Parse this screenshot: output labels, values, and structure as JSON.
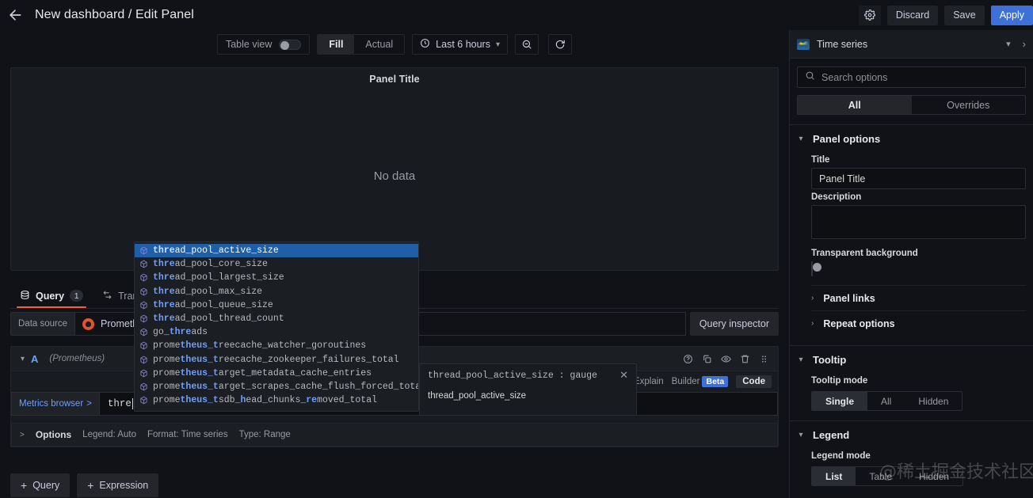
{
  "topbar": {
    "back_icon": "arrow-left-icon",
    "breadcrumb": "New dashboard / Edit Panel",
    "settings_icon": "gear-icon",
    "discard_label": "Discard",
    "save_label": "Save",
    "apply_label": "Apply"
  },
  "toolbar": {
    "table_view_label": "Table view",
    "fill_label": "Fill",
    "actual_label": "Actual",
    "time_range_label": "Last 6 hours",
    "clock_icon": "clock-icon",
    "chevron_icon": "chevron-down-icon",
    "zoom_out_icon": "zoom-out-icon",
    "refresh_icon": "refresh-icon"
  },
  "panel_preview": {
    "title": "Panel Title",
    "no_data": "No data"
  },
  "tabs": [
    {
      "label": "Query",
      "badge": "1",
      "icon": "database-icon",
      "active": true
    },
    {
      "label": "Transform",
      "badge": "",
      "icon": "transform-icon",
      "active": false
    }
  ],
  "query_editor": {
    "data_source_label": "Data source",
    "data_source_value": "Prometheus",
    "data_source_icon": "prometheus-icon",
    "query_inspector_label": "Query inspector",
    "ref_id": "A",
    "ref_ds": "(Prometheus)",
    "row_actions": [
      "help-icon",
      "duplicate-icon",
      "eye-icon",
      "trash-icon",
      "drag-handle-icon"
    ],
    "explain_label": "Explain",
    "builder_label": "Builder",
    "beta_label": "Beta",
    "code_label": "Code",
    "metrics_browser_label": "Metrics browser",
    "metrics_browser_caret": ">",
    "code_value": "thre",
    "options": {
      "caret": ">",
      "title": "Options",
      "legend": "Legend: Auto",
      "format": "Format: Time series",
      "type": "Type: Range"
    },
    "add_query_label": "Query",
    "add_expression_label": "Expression"
  },
  "doc_popup": {
    "signature": "thread_pool_active_size : gauge",
    "close_icon": "close-icon",
    "body": "thread_pool_active_size"
  },
  "autocomplete": {
    "icon": "cube-icon",
    "items": [
      {
        "pre": "thre",
        "post": "ad_pool_active_size",
        "selected": true
      },
      {
        "pre": "thre",
        "post": "ad_pool_core_size",
        "selected": false
      },
      {
        "pre": "thre",
        "post": "ad_pool_largest_size",
        "selected": false
      },
      {
        "pre": "thre",
        "post": "ad_pool_max_size",
        "selected": false
      },
      {
        "pre": "thre",
        "post": "ad_pool_queue_size",
        "selected": false
      },
      {
        "pre": "thre",
        "post": "ad_pool_thread_count",
        "selected": false
      },
      {
        "parts": [
          [
            "go_",
            false
          ],
          [
            "thre",
            true
          ],
          [
            "ads",
            false
          ]
        ],
        "selected": false
      },
      {
        "parts": [
          [
            "prome",
            false
          ],
          [
            "theus_t",
            true
          ],
          [
            "ree",
            false
          ],
          [
            "cache_watcher_goroutines",
            false
          ]
        ],
        "selected": false
      },
      {
        "parts": [
          [
            "prome",
            false
          ],
          [
            "theus_t",
            true
          ],
          [
            "ree",
            false
          ],
          [
            "cache_zookeeper_failures_total",
            false
          ]
        ],
        "selected": false
      },
      {
        "parts": [
          [
            "prome",
            false
          ],
          [
            "theus_t",
            true
          ],
          [
            "arget_metadata_cache_entries",
            false
          ]
        ],
        "selected": false
      },
      {
        "parts": [
          [
            "prome",
            false
          ],
          [
            "theus_t",
            true
          ],
          [
            "arget_scrapes_cache_flush_forced_total",
            false
          ]
        ],
        "selected": false
      },
      {
        "parts": [
          [
            "prome",
            false
          ],
          [
            "theus_t",
            true
          ],
          [
            "sdb_",
            false
          ],
          [
            "h",
            true
          ],
          [
            "ead_chunks_",
            false
          ],
          [
            "re",
            true
          ],
          [
            "moved_total",
            false
          ]
        ],
        "selected": false
      }
    ]
  },
  "sidebar": {
    "viz_name": "Time series",
    "viz_icon": "timeseries-icon",
    "viz_chevron": "chevron-down-icon",
    "viz_next": "angle-right-icon",
    "search_placeholder": "Search options",
    "search_icon": "search-icon",
    "tab_all": "All",
    "tab_overrides": "Overrides",
    "panel_options": {
      "title": "Panel options",
      "title_label": "Title",
      "title_value": "Panel Title",
      "description_label": "Description",
      "description_value": "",
      "transparent_label": "Transparent background",
      "panel_links_label": "Panel links",
      "repeat_options_label": "Repeat options"
    },
    "tooltip": {
      "title": "Tooltip",
      "mode_label": "Tooltip mode",
      "modes": [
        "Single",
        "All",
        "Hidden"
      ],
      "selected": "Single"
    },
    "legend": {
      "title": "Legend",
      "mode_label": "Legend mode",
      "modes": [
        "List",
        "Table",
        "Hidden"
      ],
      "selected": "List"
    }
  },
  "watermark": "@稀土掘金技术社区",
  "colors": {
    "accent": "#3d71d9",
    "tab_underline": "#f55f3e",
    "prometheus": "#e6522c",
    "highlight_blue": "#6e9fff",
    "selection": "#1f5fa8"
  }
}
